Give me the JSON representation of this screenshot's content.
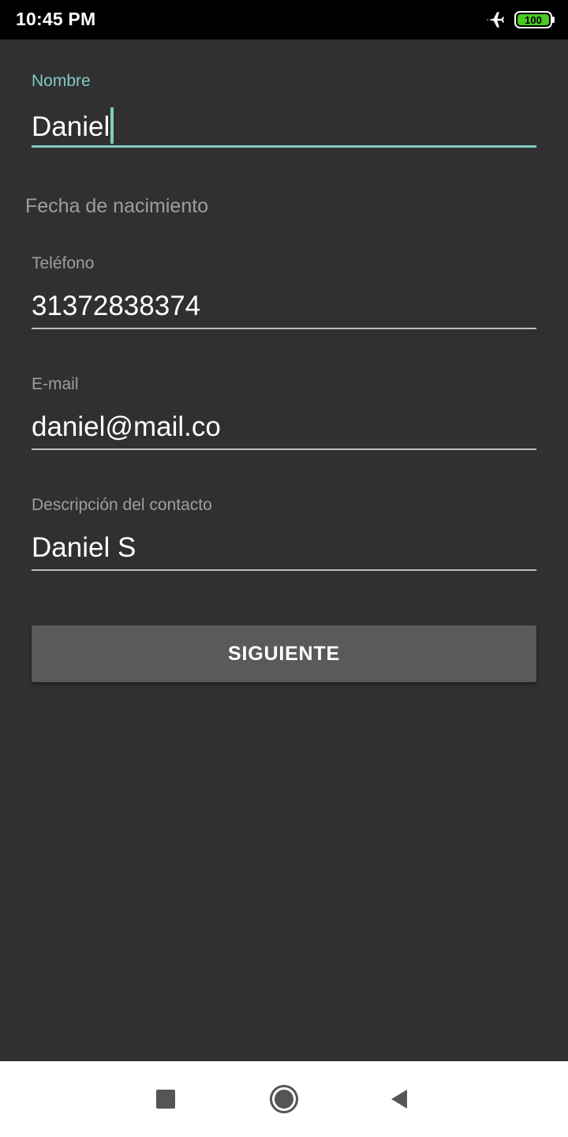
{
  "status_bar": {
    "time": "10:45 PM",
    "battery_level": "100",
    "icons": [
      "airplane-mode-icon",
      "battery-icon"
    ],
    "battery_color": "#4bc821"
  },
  "form": {
    "name": {
      "label": "Nombre",
      "value": "Daniel",
      "focused": true
    },
    "birth_date": {
      "label": "Fecha de nacimiento"
    },
    "phone": {
      "label": "Teléfono",
      "value": "31372838374"
    },
    "email": {
      "label": "E-mail",
      "value": "daniel@mail.co"
    },
    "description": {
      "label": "Descripción del contacto",
      "value": "Daniel S"
    },
    "next_button_label": "SIGUIENTE"
  },
  "nav_bar": {
    "icons": [
      "recents-square-icon",
      "home-circle-icon",
      "back-triangle-icon"
    ]
  },
  "colors": {
    "background": "#303030",
    "accent": "#80cbc4",
    "button": "#5a5a5c",
    "label": "#9e9e9e",
    "text": "#ffffff",
    "nav_background": "#ffffff"
  }
}
